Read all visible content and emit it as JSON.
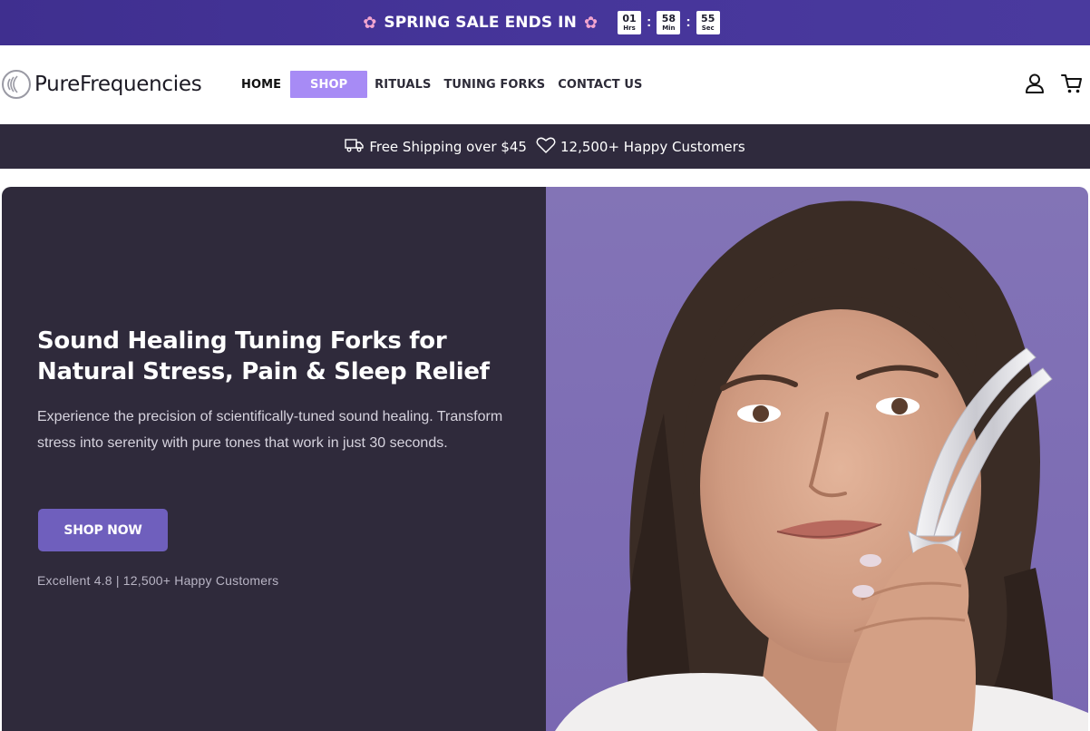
{
  "promo": {
    "text": "SPRING SALE ENDS IN",
    "flower_icon": "cherry-blossom",
    "timer": [
      {
        "value": "01",
        "unit": "Hrs"
      },
      {
        "value": "58",
        "unit": "Min"
      },
      {
        "value": "55",
        "unit": "Sec"
      }
    ],
    "separator": ":",
    "colors": {
      "background": "#4536a0",
      "box": "#ffffff"
    }
  },
  "header": {
    "logo_text": "PureFrequencies",
    "nav": [
      {
        "label": "HOME"
      },
      {
        "label": "SHOP",
        "active": true
      },
      {
        "label": "RITUALS"
      },
      {
        "label": "TUNING FORKS"
      },
      {
        "label": "CONTACT US"
      }
    ],
    "icons": [
      "user-icon",
      "cart-icon"
    ],
    "active_color": "#a78bf5"
  },
  "shipping_bar": {
    "shipping_text": "Free Shipping over $45",
    "customers_text": "12,500+ Happy Customers",
    "icons": [
      "truck-icon",
      "heart-icon"
    ]
  },
  "hero": {
    "title": "Sound Healing Tuning Forks for Natural Stress, Pain & Sleep Relief",
    "description": "Experience the precision of scientifically-tuned sound healing. Transform stress into serenity with pure tones that work in just 30 seconds.",
    "cta_label": "SHOP NOW",
    "rating_text": "Excellent 4.8 | 12,500+ Happy Customers",
    "colors": {
      "panel": "#2f2a3b",
      "cta": "#6f5fbd",
      "photo_bg": "#7f6fb5"
    }
  }
}
